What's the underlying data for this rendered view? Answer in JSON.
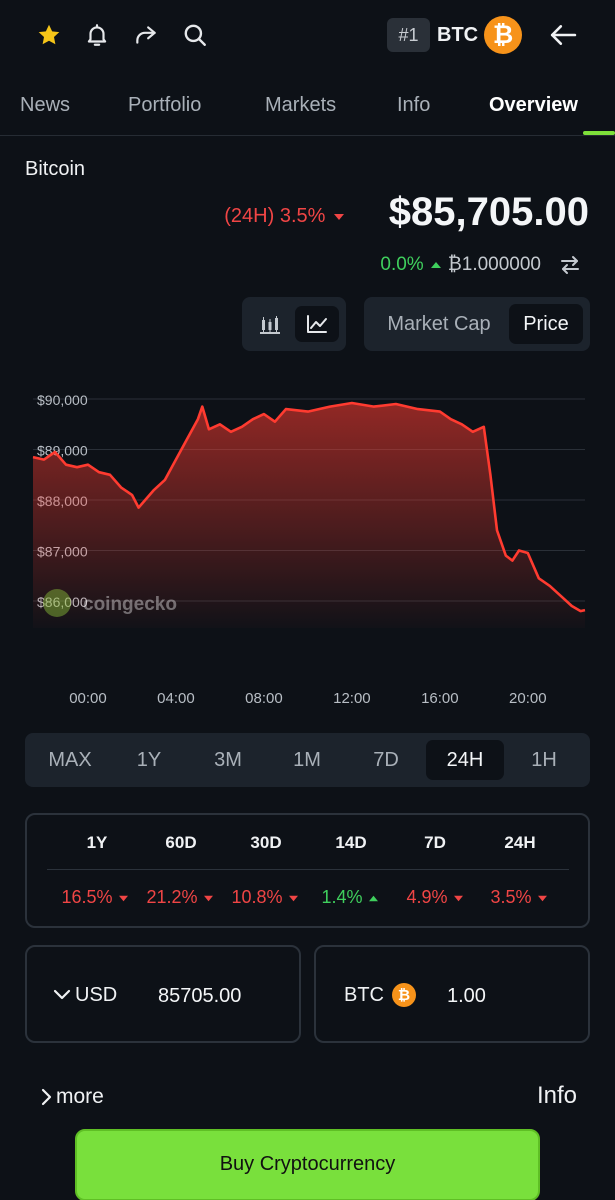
{
  "header": {
    "rank": "#1",
    "symbol": "BTC",
    "logo_glyph": "₿",
    "icons": [
      "star-icon",
      "bell-icon",
      "share-icon",
      "search-icon",
      "back-arrow-icon"
    ],
    "colors": {
      "star": "#f5c518",
      "btc": "#f7931a"
    }
  },
  "tabs": [
    {
      "label": "News",
      "active": false
    },
    {
      "label": "Portfolio",
      "active": false
    },
    {
      "label": "Markets",
      "active": false
    },
    {
      "label": "Info",
      "active": false
    },
    {
      "label": "Overview",
      "active": true
    }
  ],
  "coin": {
    "name": "Bitcoin",
    "change_period": "(24H)",
    "change_pct": "3.5%",
    "change_dir": "down",
    "price": "$85,705.00",
    "btc_change_pct": "0.0%",
    "btc_change_dir": "up",
    "btc_price": "₿1.000000"
  },
  "chart_controls": {
    "styles": [
      {
        "icon": "candlestick-icon",
        "selected": false
      },
      {
        "icon": "line-chart-icon",
        "selected": true
      }
    ],
    "metrics": [
      {
        "label": "Market Cap",
        "selected": false
      },
      {
        "label": "Price",
        "selected": true
      }
    ]
  },
  "chart_data": {
    "type": "area",
    "title": "",
    "xlabel": "",
    "ylabel": "",
    "y_ticks": [
      {
        "value": 90000,
        "label": "$90,000"
      },
      {
        "value": 89000,
        "label": "$89,000"
      },
      {
        "value": 88000,
        "label": "$88,000"
      },
      {
        "value": 87000,
        "label": "$87,000"
      },
      {
        "value": 86000,
        "label": "$86,000"
      }
    ],
    "x_ticks": [
      {
        "value": 1,
        "label": "00:00"
      },
      {
        "value": 5,
        "label": "04:00"
      },
      {
        "value": 9,
        "label": "08:00"
      },
      {
        "value": 13,
        "label": "12:00"
      },
      {
        "value": 17,
        "label": "16:00"
      },
      {
        "value": 21,
        "label": "20:00"
      }
    ],
    "xlim": [
      -1.5,
      23.6
    ],
    "ylim": [
      85600,
      90000
    ],
    "grid": true,
    "watermark": "coingecko",
    "color": "#ff3b30",
    "series": [
      {
        "name": "",
        "x": [
          -1.5,
          -1.0,
          -0.5,
          0.0,
          0.5,
          1.0,
          1.5,
          2.0,
          2.5,
          3.0,
          3.3,
          3.6,
          4.0,
          4.5,
          5.0,
          5.5,
          6.0,
          6.2,
          6.5,
          7.0,
          7.5,
          8.0,
          8.5,
          9.0,
          9.5,
          10.0,
          11.0,
          12.0,
          13.0,
          14.0,
          15.0,
          16.0,
          17.0,
          17.5,
          18.0,
          18.5,
          19.0,
          19.3,
          19.6,
          20.0,
          20.3,
          20.6,
          21.0,
          21.5,
          22.0,
          22.5,
          23.0,
          23.4,
          23.6
        ],
        "y": [
          88850,
          88800,
          88950,
          88700,
          88650,
          88700,
          88550,
          88500,
          88250,
          88100,
          87850,
          88000,
          88200,
          88400,
          88800,
          89200,
          89600,
          89850,
          89400,
          89500,
          89350,
          89450,
          89600,
          89700,
          89550,
          89800,
          89750,
          89850,
          89920,
          89850,
          89900,
          89800,
          89750,
          89600,
          89500,
          89350,
          89450,
          88500,
          87400,
          86900,
          86800,
          87000,
          86950,
          86450,
          86300,
          86100,
          85900,
          85800,
          85820
        ]
      }
    ]
  },
  "ranges": [
    {
      "label": "MAX",
      "selected": false
    },
    {
      "label": "1Y",
      "selected": false
    },
    {
      "label": "3M",
      "selected": false
    },
    {
      "label": "1M",
      "selected": false
    },
    {
      "label": "7D",
      "selected": false
    },
    {
      "label": "24H",
      "selected": true
    },
    {
      "label": "1H",
      "selected": false
    }
  ],
  "performance": [
    {
      "period": "1Y",
      "value": "16.5%",
      "dir": "down"
    },
    {
      "period": "60D",
      "value": "21.2%",
      "dir": "down"
    },
    {
      "period": "30D",
      "value": "10.8%",
      "dir": "down"
    },
    {
      "period": "14D",
      "value": "1.4%",
      "dir": "up"
    },
    {
      "period": "7D",
      "value": "4.9%",
      "dir": "down"
    },
    {
      "period": "24H",
      "value": "3.5%",
      "dir": "down"
    }
  ],
  "converter": {
    "fiat_label": "USD",
    "fiat_value": "85705.00",
    "crypto_label": "BTC",
    "crypto_value": "1.00"
  },
  "footer": {
    "more_label": "more",
    "info_label": "Info",
    "buy_label": "Buy Cryptocurrency"
  }
}
